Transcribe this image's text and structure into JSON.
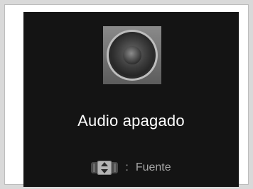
{
  "screen": {
    "status_text": "Audio apagado",
    "speaker_icon": "speaker-icon",
    "hint": {
      "icon": "knob-icon",
      "separator": ":",
      "label": "Fuente"
    }
  },
  "colors": {
    "screen_bg": "#141414",
    "text_primary": "#ffffff",
    "text_secondary": "#a6a6a6"
  }
}
